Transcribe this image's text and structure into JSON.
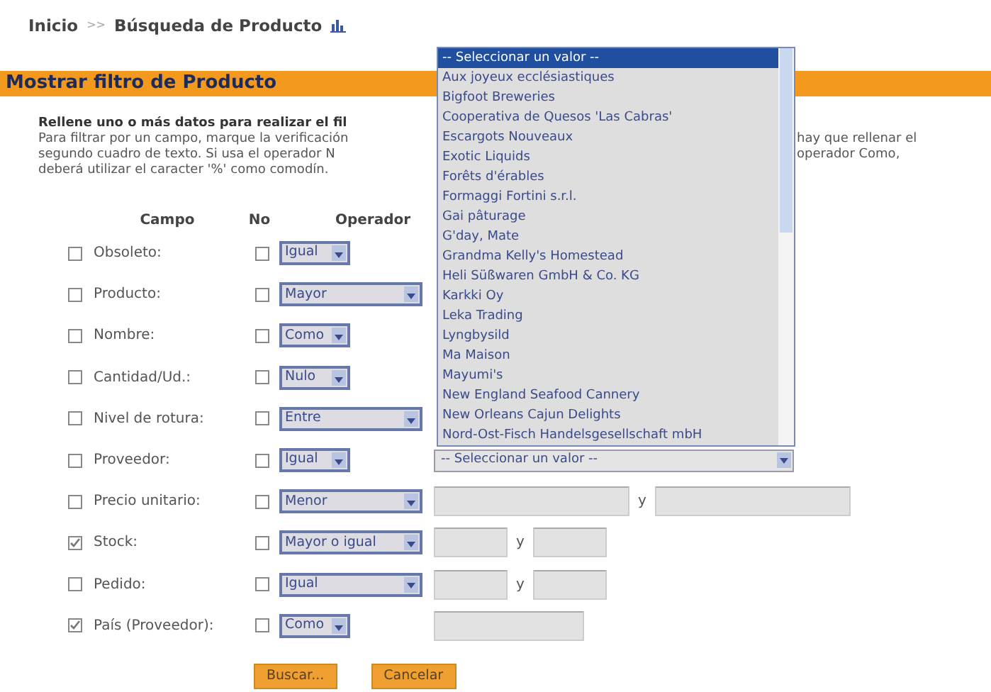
{
  "breadcrumb": {
    "home": "Inicio",
    "separator": ">>",
    "current": "Búsqueda de Producto"
  },
  "title": "Mostrar filtro de Producto",
  "description": [
    {
      "left": "Rellene uno o más datos para realizar el fil",
      "bold": true
    },
    {
      "left": "Para filtrar por un campo, marque la verificación",
      "right": "hay que rellenar el",
      "bold": false
    },
    {
      "left": "segundo cuadro de texto. Si usa el operador N",
      "right": "operador Como,",
      "bold": false
    },
    {
      "left": "deberá utilizar el caracter '%' como comodín.",
      "bold": false
    }
  ],
  "columns": [
    "Campo",
    "No",
    "Operador"
  ],
  "rows": [
    {
      "checked": false,
      "label": "Obsoleto:",
      "negate": false,
      "operator": "Igual",
      "wide": false
    },
    {
      "checked": false,
      "label": "Producto:",
      "negate": false,
      "operator": "Mayor",
      "wide": true
    },
    {
      "checked": false,
      "label": "Nombre:",
      "negate": false,
      "operator": "Como",
      "wide": false
    },
    {
      "checked": false,
      "label": "Cantidad/Ud.:",
      "negate": false,
      "operator": "Nulo",
      "wide": false
    },
    {
      "checked": false,
      "label": "Nivel de rotura:",
      "negate": false,
      "operator": "Entre",
      "wide": true
    },
    {
      "checked": false,
      "label": "Proveedor:",
      "negate": false,
      "operator": "Igual",
      "wide": false,
      "value": {
        "kind": "select",
        "text": "-- Seleccionar un valor --"
      }
    },
    {
      "checked": false,
      "label": "Precio unitario:",
      "negate": false,
      "operator": "Menor",
      "wide": true,
      "value": {
        "kind": "range",
        "wide": true,
        "separator": "y"
      }
    },
    {
      "checked": true,
      "label": "Stock:",
      "negate": false,
      "operator": "Mayor o igual",
      "wide": true,
      "value": {
        "kind": "range",
        "wide": false,
        "separator": "y"
      }
    },
    {
      "checked": false,
      "label": "Pedido:",
      "negate": false,
      "operator": "Igual",
      "wide": true,
      "value": {
        "kind": "range",
        "wide": false,
        "separator": "y"
      }
    },
    {
      "checked": true,
      "label": "País (Proveedor):",
      "negate": false,
      "operator": "Como",
      "wide": false,
      "value": {
        "kind": "single"
      }
    }
  ],
  "dropdown_options": [
    {
      "text": "-- Seleccionar un valor --",
      "selected": true
    },
    {
      "text": "Aux joyeux ecclésiastiques",
      "selected": false
    },
    {
      "text": "Bigfoot Breweries",
      "selected": false
    },
    {
      "text": "Cooperativa de Quesos 'Las Cabras'",
      "selected": false
    },
    {
      "text": "Escargots Nouveaux",
      "selected": false
    },
    {
      "text": "Exotic Liquids",
      "selected": false
    },
    {
      "text": "Forêts d'érables",
      "selected": false
    },
    {
      "text": "Formaggi Fortini s.r.l.",
      "selected": false
    },
    {
      "text": "Gai pâturage",
      "selected": false
    },
    {
      "text": "G'day, Mate",
      "selected": false
    },
    {
      "text": "Grandma Kelly's Homestead",
      "selected": false
    },
    {
      "text": "Heli Süßwaren GmbH & Co. KG",
      "selected": false
    },
    {
      "text": "Karkki Oy",
      "selected": false
    },
    {
      "text": "Leka Trading",
      "selected": false
    },
    {
      "text": "Lyngbysild",
      "selected": false
    },
    {
      "text": "Ma Maison",
      "selected": false
    },
    {
      "text": "Mayumi's",
      "selected": false
    },
    {
      "text": "New England Seafood Cannery",
      "selected": false
    },
    {
      "text": "New Orleans Cajun Delights",
      "selected": false
    },
    {
      "text": "Nord-Ost-Fisch Handelsgesellschaft mbH",
      "selected": false
    }
  ],
  "buttons": [
    "Buscar...",
    "Cancelar"
  ]
}
